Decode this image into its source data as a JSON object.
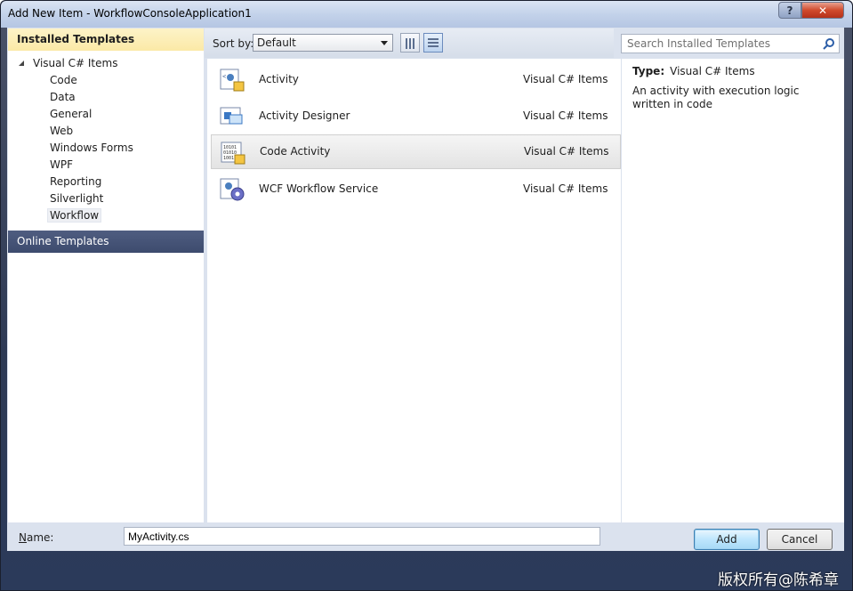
{
  "window": {
    "title": "Add New Item - WorkflowConsoleApplication1",
    "help_label": "?",
    "close_label": "✕"
  },
  "sidebar": {
    "installed_header": "Installed Templates",
    "root_label": "Visual C# Items",
    "items": [
      {
        "label": "Code"
      },
      {
        "label": "Data"
      },
      {
        "label": "General"
      },
      {
        "label": "Web"
      },
      {
        "label": "Windows Forms"
      },
      {
        "label": "WPF"
      },
      {
        "label": "Reporting"
      },
      {
        "label": "Silverlight"
      },
      {
        "label": "Workflow"
      }
    ],
    "selected_item": "Workflow",
    "online_header": "Online Templates"
  },
  "toolbar": {
    "sort_label": "Sort by:",
    "sort_value": "Default"
  },
  "templates": [
    {
      "name": "Activity",
      "category": "Visual C# Items",
      "icon": "activity-icon"
    },
    {
      "name": "Activity Designer",
      "category": "Visual C# Items",
      "icon": "activity-designer-icon"
    },
    {
      "name": "Code Activity",
      "category": "Visual C# Items",
      "icon": "code-activity-icon",
      "selected": true
    },
    {
      "name": "WCF Workflow Service",
      "category": "Visual C# Items",
      "icon": "wcf-service-icon"
    }
  ],
  "search": {
    "placeholder": "Search Installed Templates"
  },
  "details": {
    "type_label": "Type:",
    "type_value": "Visual C# Items",
    "description": "An activity with execution logic written in code"
  },
  "name_field": {
    "label_prefix": "N",
    "label_rest": "ame:",
    "value": "MyActivity.cs"
  },
  "buttons": {
    "add": "Add",
    "cancel": "Cancel"
  },
  "watermark": "版权所有@陈希章"
}
